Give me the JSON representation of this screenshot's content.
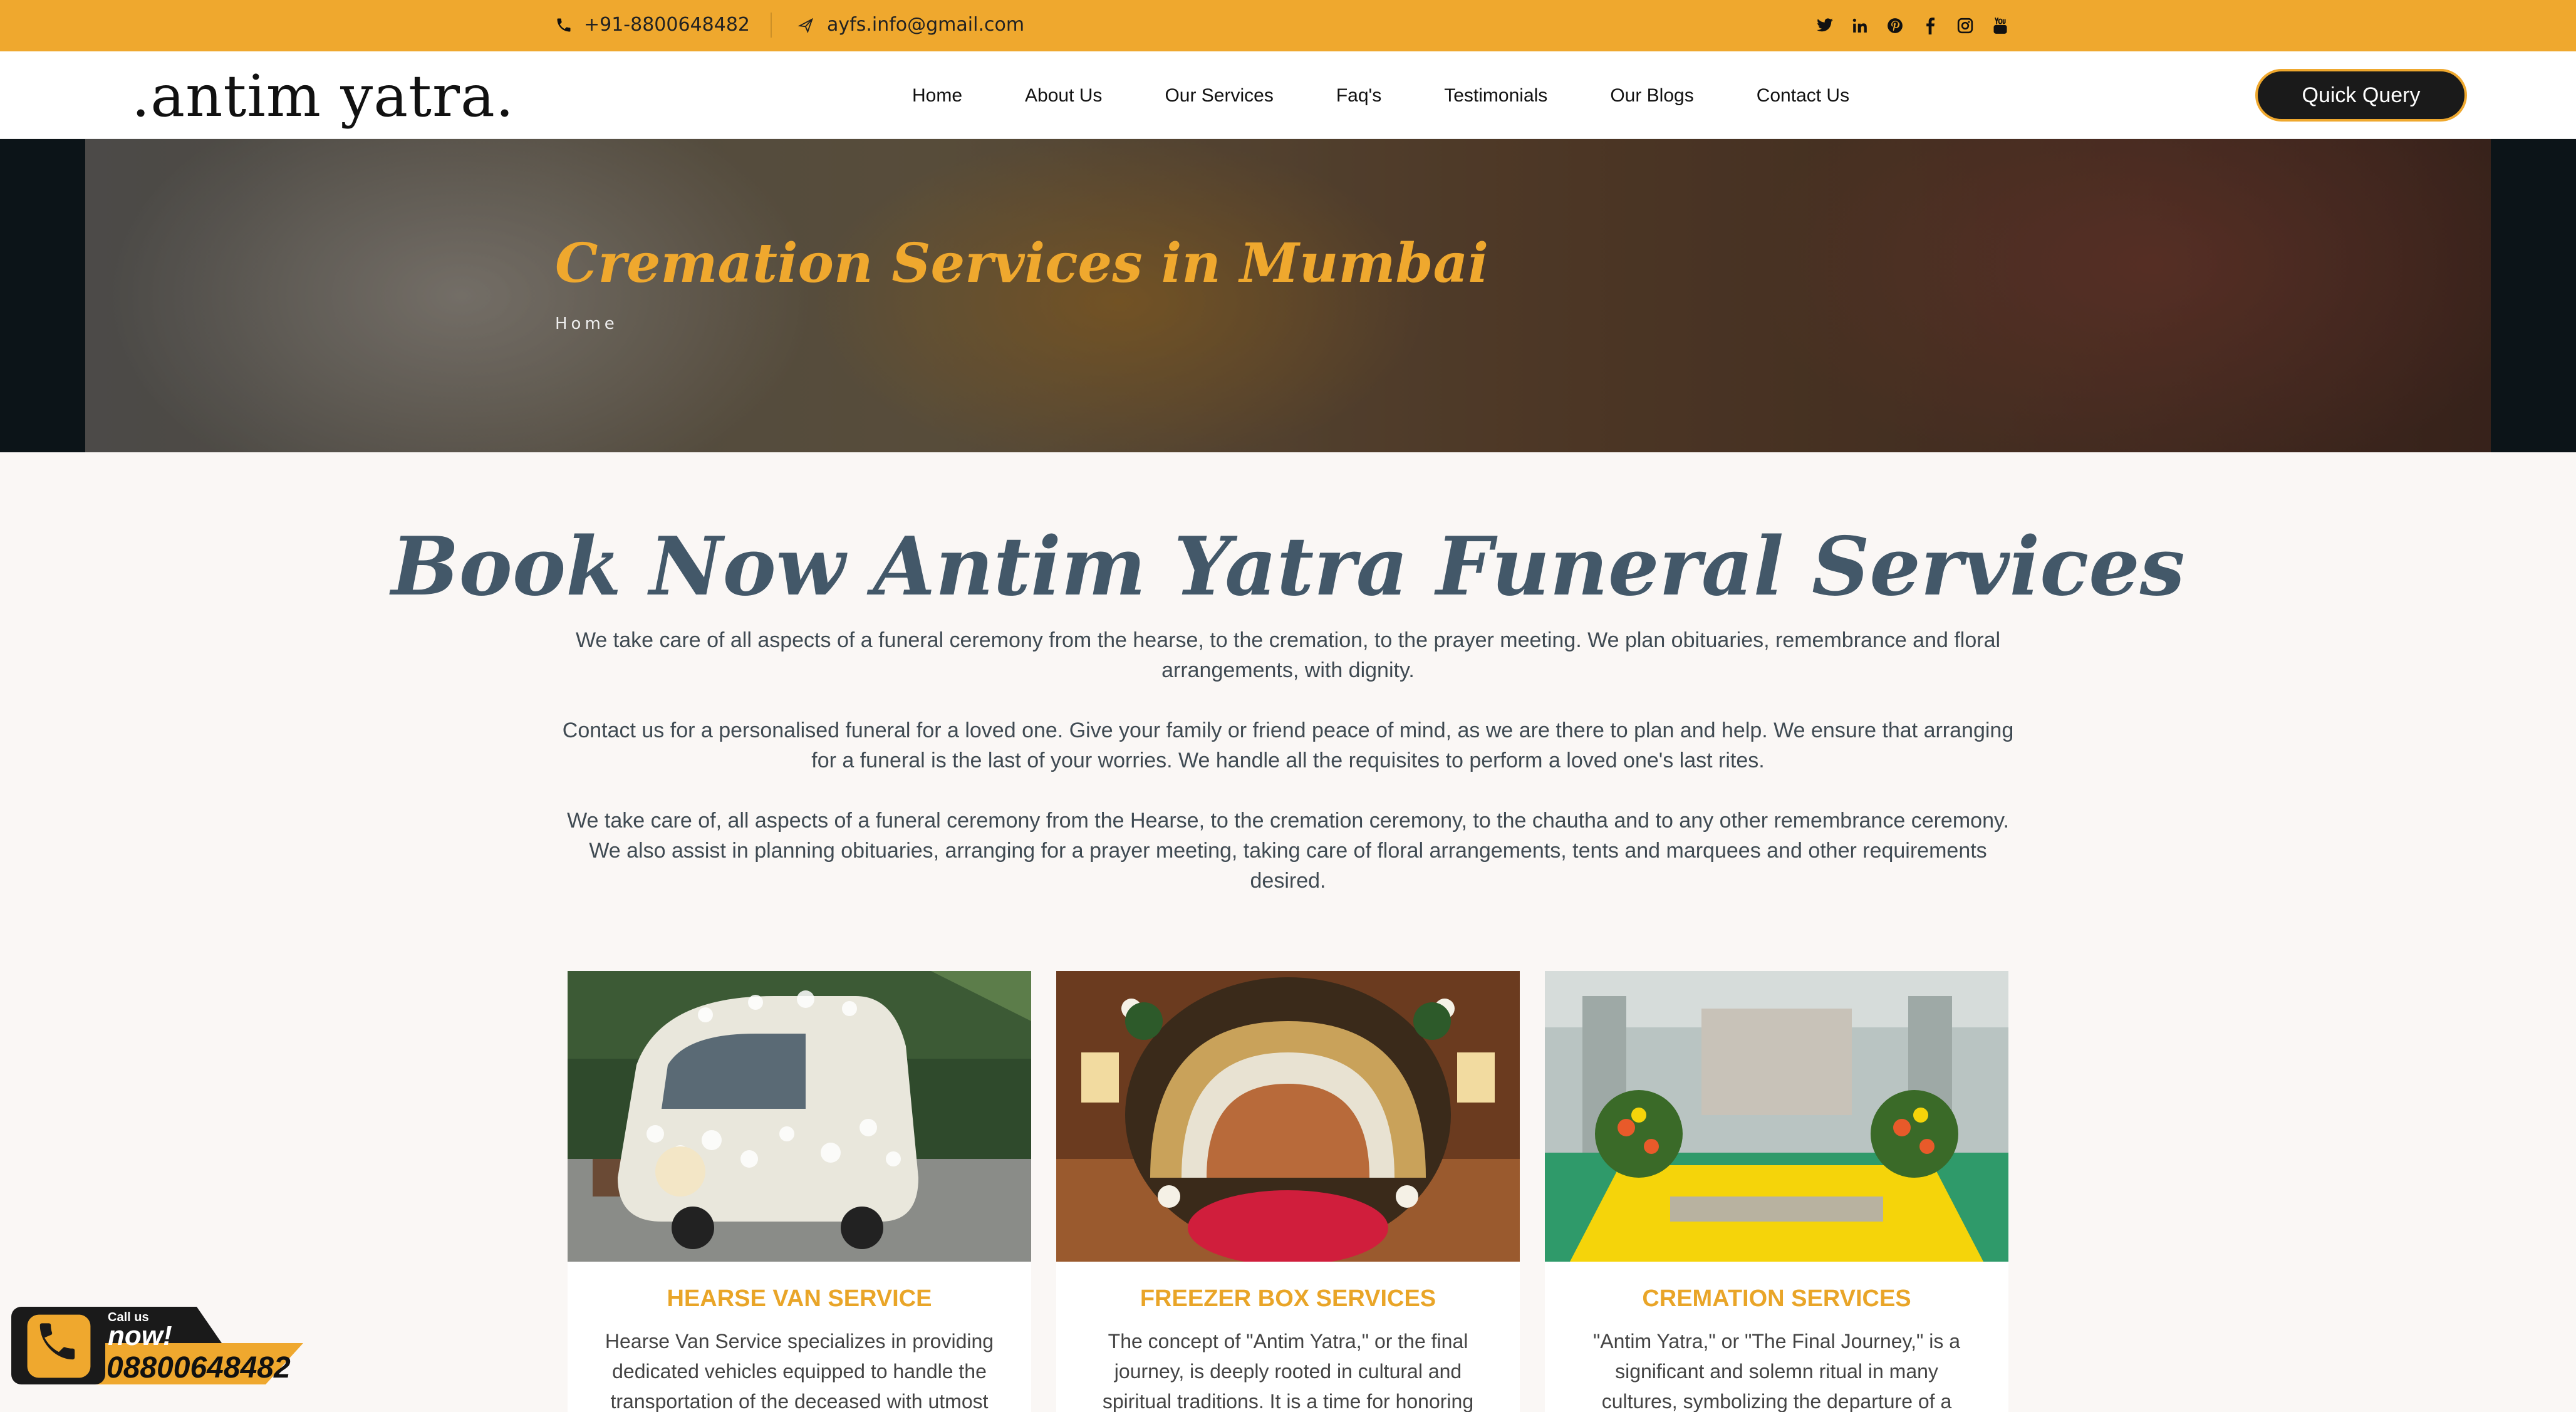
{
  "topbar": {
    "phone": "+91-8800648482",
    "email": "ayfs.info@gmail.com",
    "socials": [
      "twitter-icon",
      "linkedin-icon",
      "pinterest-icon",
      "facebook-icon",
      "instagram-icon",
      "youtube-icon"
    ]
  },
  "header": {
    "logo": ".antim yatra.",
    "nav": [
      "Home",
      "About Us",
      "Our Services",
      "Faq's",
      "Testimonials",
      "Our Blogs",
      "Contact Us"
    ],
    "quick_query": "Quick Query"
  },
  "hero": {
    "title": "Cremation Services in Mumbai",
    "breadcrumb": "Home"
  },
  "main": {
    "title": "Book Now Antim Yatra Funeral Services",
    "paragraphs": [
      "We take care of all aspects of a funeral ceremony from the hearse, to the cremation, to the prayer meeting. We plan obituaries, remembrance and floral arrangements, with dignity.",
      "Contact us for a personalised funeral for a loved one. Give your family or friend peace of mind, as we are there to plan and help. We ensure that arranging for a funeral is the last of your worries. We handle all the requisites to perform a loved one's last rites.",
      "We take care of, all aspects of a funeral ceremony from the Hearse, to the cremation ceremony, to the chautha and to any other remembrance ceremony. We also assist in planning obituaries, arranging for a prayer meeting, taking care of floral arrangements, tents and marquees and other requirements desired."
    ]
  },
  "cards": [
    {
      "title": "HEARSE VAN SERVICE",
      "text": "Hearse Van Service specializes in providing dedicated vehicles equipped to handle the transportation of the deceased with utmost"
    },
    {
      "title": "FREEZER BOX SERVICES",
      "text": "The concept of \"Antim Yatra,\" or the final journey, is deeply rooted in cultural and spiritual traditions. It is a time for honoring"
    },
    {
      "title": "CREMATION SERVICES",
      "text": "\"Antim Yatra,\" or \"The Final Journey,\" is a significant and solemn ritual in many cultures, symbolizing the departure of a"
    }
  ],
  "callnow": {
    "small": "Call us",
    "big": "now!",
    "number": "08800648482"
  },
  "colors": {
    "accent": "#efa82e",
    "heading": "#435869",
    "dark": "#1a1a1a"
  }
}
